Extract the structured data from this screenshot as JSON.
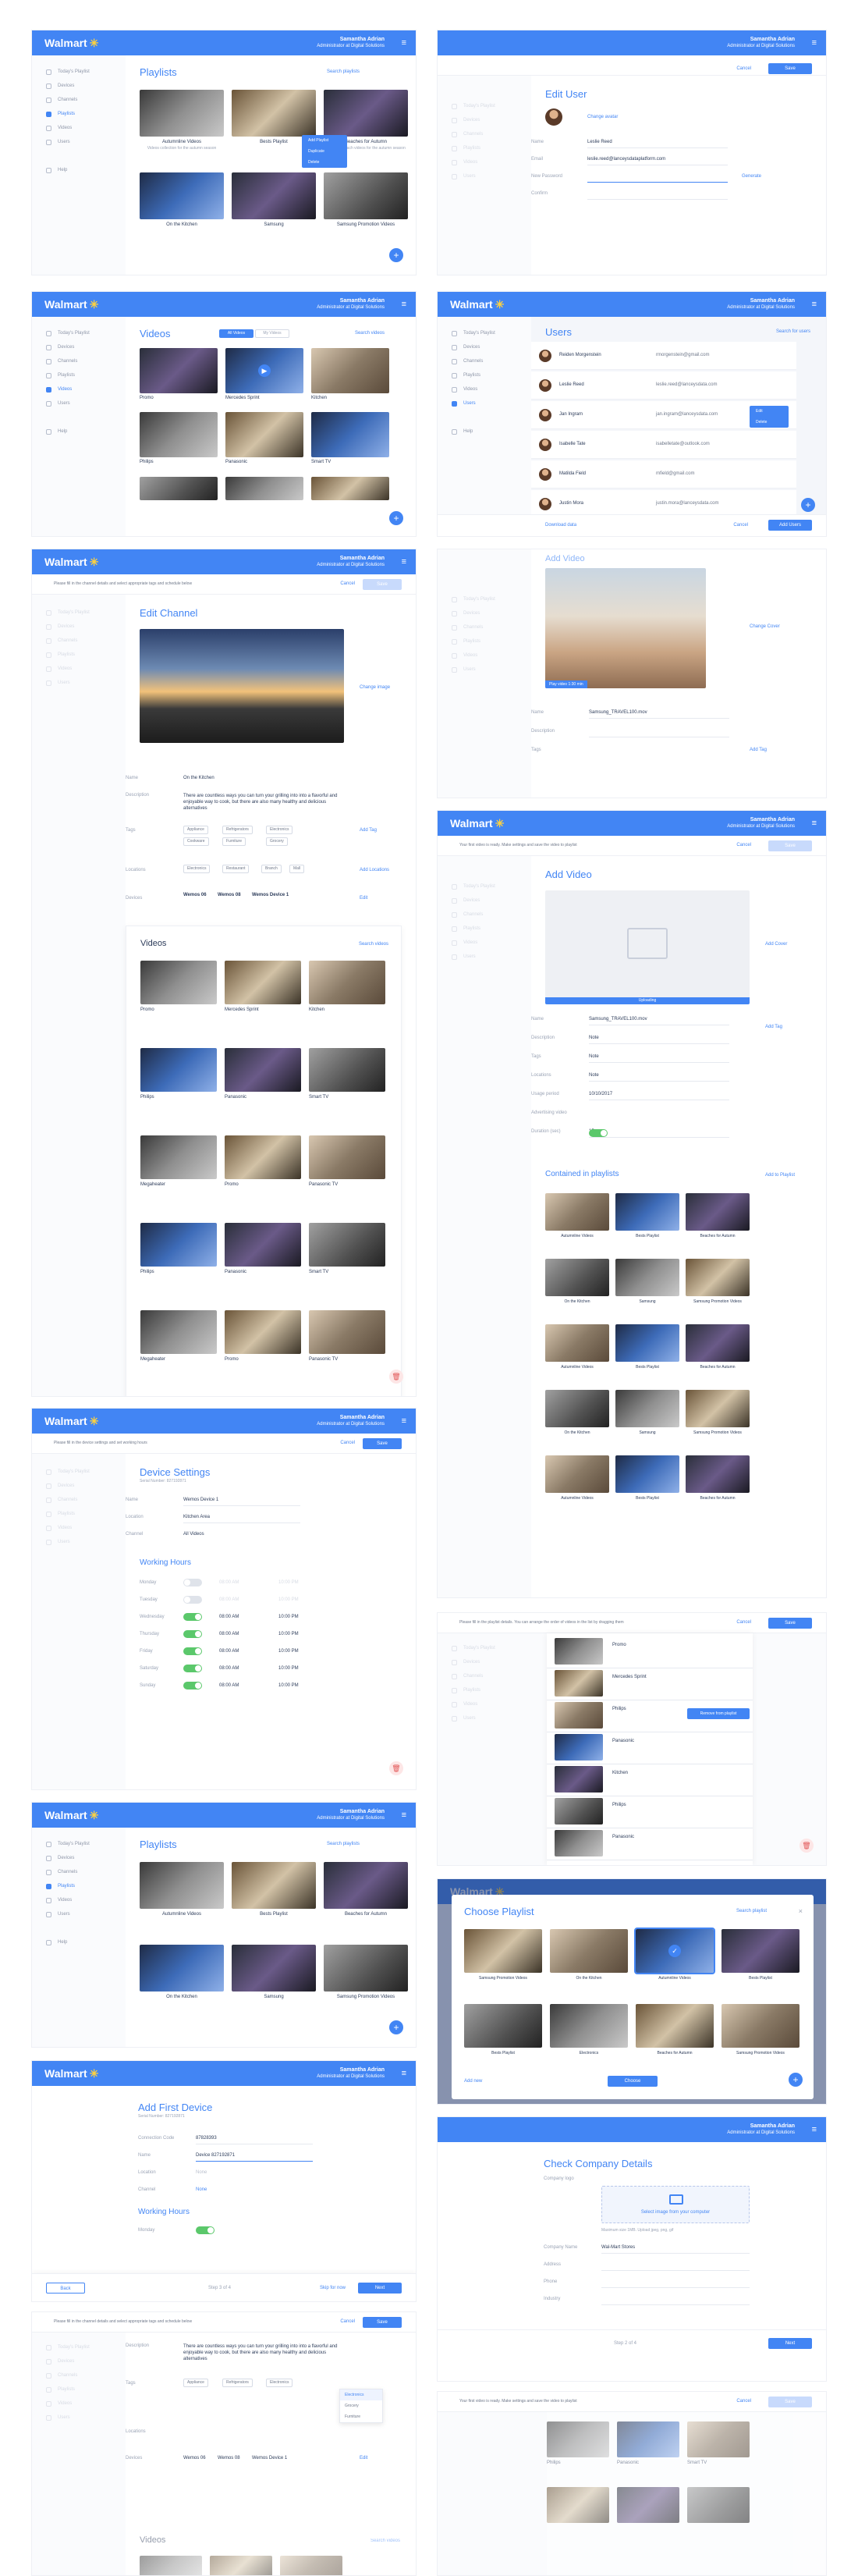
{
  "brand": {
    "name": "Walmart",
    "spark": "✳"
  },
  "user": {
    "name": "Samantha Adrian",
    "role": "Administrator at Digital Solutions"
  },
  "sidebar": {
    "items": [
      "Today's Playlist",
      "Devices",
      "Channels",
      "Playlists",
      "Videos",
      "Users",
      "Help"
    ]
  },
  "playlists": {
    "title": "Playlists",
    "search": "Search playlists",
    "items": [
      {
        "name": "Autumnline Videos",
        "desc": "Videos collection for the autumn season"
      },
      {
        "name": "Bests Playlist",
        "desc": "Best videos of the week"
      },
      {
        "name": "Beaches for Autumn",
        "desc": "Beautiful beach videos for the autumn season"
      },
      {
        "name": "On the Kitchen",
        "desc": "Videos curated for the kitchen department"
      },
      {
        "name": "Samsung",
        "desc": "Samsung product videos"
      },
      {
        "name": "Samsung Promotion Videos",
        "desc": "Samsung product promotions"
      }
    ],
    "menu": [
      "Add Playlist",
      "Duplicate",
      "Delete"
    ]
  },
  "edit_user": {
    "title": "Edit User",
    "change_avatar": "Change avatar",
    "cancel": "Cancel",
    "save": "Save",
    "fields": [
      {
        "label": "Name",
        "value": "Leslie Reed"
      },
      {
        "label": "Email",
        "value": "leslie.reed@lanceysdataplatform.com"
      },
      {
        "label": "New Password",
        "value": ""
      },
      {
        "label": "Confirm",
        "value": ""
      }
    ],
    "generate": "Generate"
  },
  "videos": {
    "title": "Videos",
    "tabs": [
      "All Videos",
      "My Videos"
    ],
    "search": "Search videos",
    "badge": "Play video 1:30 min",
    "items": [
      {
        "name": "Promo",
        "desc": "No description"
      },
      {
        "name": "Mercedes Sprint",
        "desc": "No description"
      },
      {
        "name": "Kitchen",
        "desc": "Videos of kitchen"
      },
      {
        "name": "Philips",
        "desc": "Philips products"
      },
      {
        "name": "Panasonic",
        "desc": "No description"
      },
      {
        "name": "Smart TV",
        "desc": "No description"
      }
    ]
  },
  "users": {
    "title": "Users",
    "search": "Search for users",
    "items": [
      {
        "name": "Reiden Morgenstein",
        "email": "rmorgenstein@gmail.com"
      },
      {
        "name": "Leslie Reed",
        "email": "leslie.reed@lanceysdata.com"
      },
      {
        "name": "Jan Ingram",
        "email": "jan.ingram@lanceysdata.com"
      },
      {
        "name": "Isabelle Tate",
        "email": "isabelletate@outlook.com"
      },
      {
        "name": "Matilda Field",
        "email": "mfield@gmail.com"
      },
      {
        "name": "Justin Mora",
        "email": "justin.mora@lanceysdata.com"
      }
    ],
    "menu": [
      "Edit",
      "Delete"
    ],
    "download": "Download data",
    "cancel": "Cancel",
    "add": "Add Users"
  },
  "edit_channel": {
    "notice": "Please fill in the channel details and select appropriate tags and schedule below",
    "cancel": "Cancel",
    "save": "Save",
    "title": "Edit Channel",
    "change_image": "Change image",
    "name_label": "Name",
    "name_value": "On the Kitchen",
    "desc_label": "Description",
    "desc_value": "There are countless ways you can turn your grilling into into a flavorful and enjoyable way to cook, but there are also many healthy and delicious alternatives",
    "tags_label": "Tags",
    "tags": [
      "Appliance",
      "Refrigerators",
      "Electronics",
      "Cookware",
      "Furniture",
      "Grocery"
    ],
    "add_tag": "Add Tag",
    "locations_label": "Locations",
    "locations": [
      "Electronics",
      "Restaurant",
      "Branch",
      "Mall"
    ],
    "add_locations": "Add Locations",
    "devices_label": "Devices",
    "devices": [
      "Wemos 06",
      "Wemos 08",
      "Wemos Device 1"
    ],
    "edit": "Edit",
    "videos_title": "Videos",
    "videos_search": "Search videos",
    "video_items": [
      "Promo",
      "Mercedes Sprint",
      "Kitchen",
      "Philips",
      "Panasonic",
      "Smart TV",
      "Megaheater",
      "Promo",
      "Panasonic TV",
      "Philips",
      "Panasonic",
      "Smart TV",
      "Megaheater",
      "Promo",
      "Panasonic TV"
    ]
  },
  "add_video": {
    "title": "Add Video",
    "change_cover": "Change Cover",
    "badge": "Play video 1:30 min",
    "fields": [
      {
        "label": "Name",
        "value": "Samsung_TRAVEL100.mov"
      },
      {
        "label": "Description",
        "value": ""
      },
      {
        "label": "Tags",
        "value": ""
      }
    ],
    "add_tag": "Add Tag"
  },
  "add_video2": {
    "notice": "Your first video is ready. Make settings and save the video to playlist",
    "cancel": "Cancel",
    "save": "Save",
    "title": "Add Video",
    "upload": "Add Cover",
    "uploading": "Uploading",
    "fields": [
      {
        "label": "Name",
        "value": "Samsung_TRAVEL100.mov"
      },
      {
        "label": "Description",
        "value": "Note"
      },
      {
        "label": "Tags",
        "value": "Note"
      },
      {
        "label": "Locations",
        "value": "Note"
      },
      {
        "label": "Usage period",
        "value": "10/10/2017"
      },
      {
        "label": "Advertising video",
        "value": ""
      },
      {
        "label": "Duration (sec)",
        "value": "15"
      }
    ],
    "contained": "Contained in playlists",
    "add_playlist": "Add to Playlist"
  },
  "device_settings": {
    "notice": "Please fill in the device settings and set working hours",
    "cancel": "Cancel",
    "save": "Save",
    "title": "Device Settings",
    "serial": "Serial Number: 827192871",
    "fields": [
      {
        "label": "Name",
        "value": "Wemos Device 1"
      },
      {
        "label": "Location",
        "value": "Kitchen Area"
      },
      {
        "label": "Channel",
        "value": "All Videos"
      }
    ],
    "hours_title": "Working Hours",
    "days": [
      "Monday",
      "Tuesday",
      "Wednesday",
      "Thursday",
      "Friday",
      "Saturday",
      "Sunday"
    ],
    "day_on": [
      false,
      false,
      true,
      true,
      true,
      true,
      true
    ],
    "from": "08:00 AM",
    "to": "10:00 PM"
  },
  "reorder": {
    "notice": "Please fill in the playlist details. You can arrange the order of videos in the list by dragging them",
    "cancel": "Cancel",
    "save": "Save",
    "items": [
      "Promo",
      "Mercedes Sprint",
      "Philips",
      "Panasonic",
      "Kitchen",
      "Philips",
      "Panasonic"
    ],
    "remove": "Remove from playlist"
  },
  "choose_playlist": {
    "title": "Choose Playlist",
    "search": "Search playlist",
    "items": [
      "Samsung Promotion Videos",
      "On the Kitchen",
      "Autumnline Videos",
      "Bests Playlist",
      "Bests Playlist",
      "Electronics",
      "Beaches for Autumn",
      "Samsung Promotion Videos"
    ],
    "add_new": "Add new",
    "choose": "Choose"
  },
  "add_first_device": {
    "title": "Add First Device",
    "serial": "Serial Number: 827192871",
    "fields": [
      {
        "label": "Connection Code",
        "value": "87828393"
      },
      {
        "label": "Name",
        "value": "Device 827192871"
      },
      {
        "label": "Location",
        "value": "None"
      },
      {
        "label": "Channel",
        "value": "None"
      }
    ],
    "hours_title": "Working Hours",
    "day": "Monday",
    "back": "Back",
    "step": "Step 3 of 4",
    "skip": "Skip for now",
    "next": "Next"
  },
  "company": {
    "title": "Check Company Details",
    "logo_label": "Company logo",
    "upload": "Select image from your computer",
    "hint": "Maximum size 1MB. Upload jpeg, png, gif",
    "fields": [
      "Company Name",
      "Address",
      "Phone",
      "Industry"
    ],
    "company_value": "Wal-Mart Stores",
    "step": "Step 2 of 4",
    "next": "Next"
  },
  "tags_dropdown": {
    "notice": "Please fill in the channel details and select appropriate tags and schedule below",
    "cancel": "Cancel",
    "save": "Save",
    "options": [
      "Electronics",
      "Grocery",
      "Furniture"
    ],
    "videos_title": "Videos",
    "videos_search": "Search videos"
  }
}
